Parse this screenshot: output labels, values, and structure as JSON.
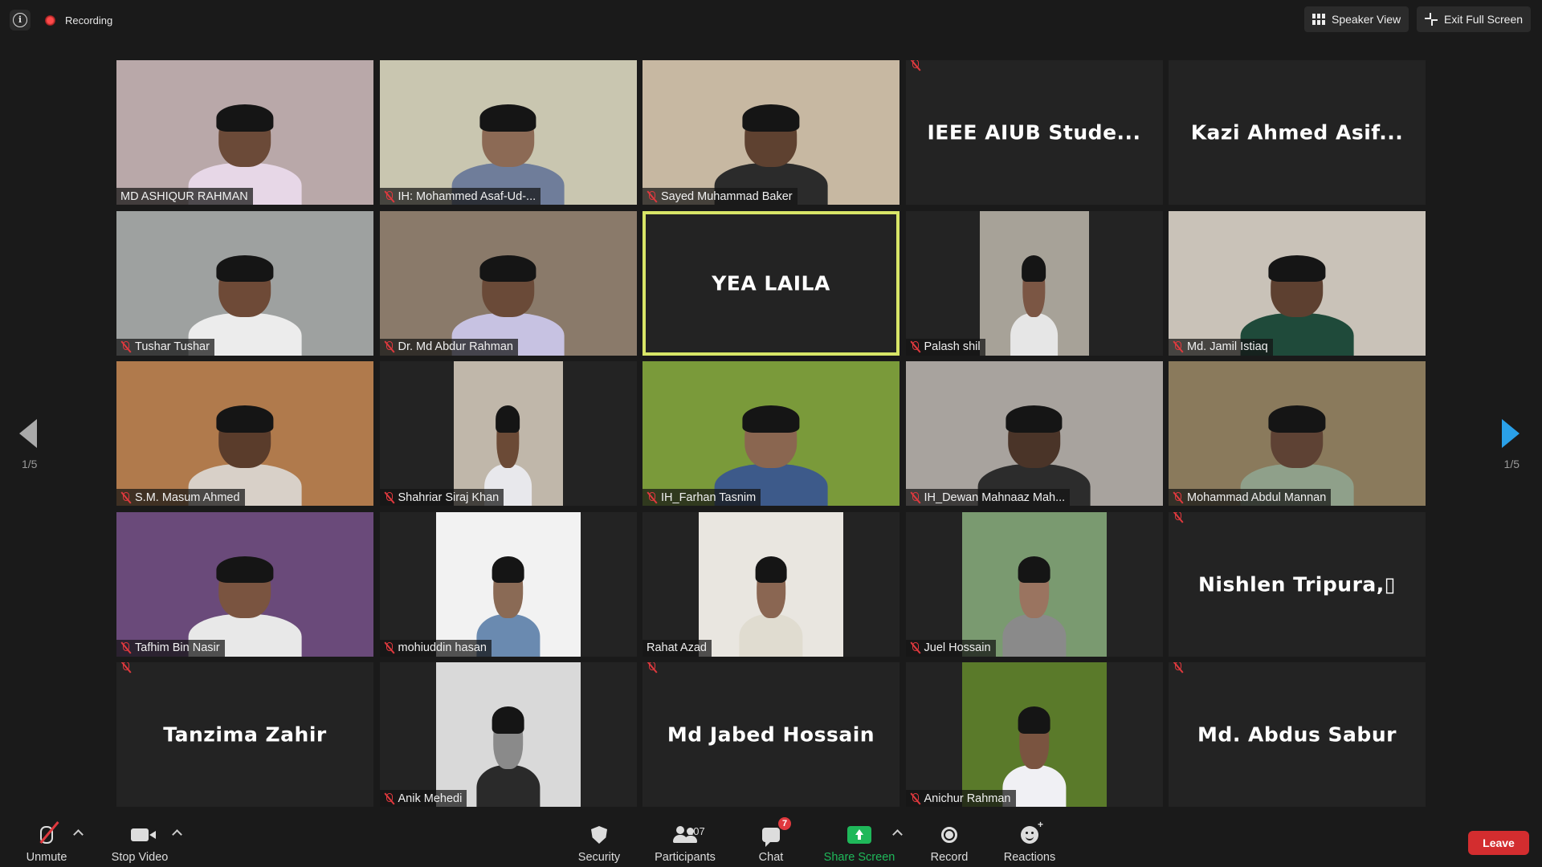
{
  "topbar": {
    "recording_label": "Recording",
    "speaker_view_label": "Speaker View",
    "exit_fullscreen_label": "Exit Full Screen"
  },
  "pagination": {
    "left": "1/5",
    "right": "1/5"
  },
  "participants": [
    {
      "name": "MD ASHIQUR RAHMAN",
      "video": true,
      "muted": false,
      "bg": "#b9a8a9",
      "skin": "#6b4a38",
      "shirt": "#e7d7e7"
    },
    {
      "name": "IH: Mohammed Asaf-Ud-...",
      "video": true,
      "muted": true,
      "bg": "#c9c6b0",
      "skin": "#8c6a55",
      "shirt": "#6f7d9a"
    },
    {
      "name": "Sayed Muhammad Baker",
      "video": true,
      "muted": true,
      "bg": "#c7b8a2",
      "skin": "#5e4130",
      "shirt": "#2b2b2b"
    },
    {
      "name": "IEEE AIUB Stude...",
      "video": false,
      "muted": true
    },
    {
      "name": "Kazi Ahmed Asif...",
      "video": false,
      "muted": false
    },
    {
      "name": "Tushar Tushar",
      "video": true,
      "muted": true,
      "bg": "#9ea1a0",
      "skin": "#6e4a37",
      "shirt": "#ececec"
    },
    {
      "name": "Dr. Md Abdur Rahman",
      "video": true,
      "muted": true,
      "bg": "#8a7a6a",
      "skin": "#6a4a38",
      "shirt": "#c7c2e2"
    },
    {
      "name": "YEA LAILA",
      "video": false,
      "muted": false,
      "active": true
    },
    {
      "name": "Palash shil",
      "video": true,
      "muted": true,
      "narrow": true,
      "bg": "#a7a298",
      "skin": "#7b5644",
      "shirt": "#e6e6e6"
    },
    {
      "name": "Md. Jamil Istiaq",
      "video": true,
      "muted": true,
      "bg": "#c9c2b8",
      "skin": "#5d4030",
      "shirt": "#1f4a3a"
    },
    {
      "name": "S.M. Masum Ahmed",
      "video": true,
      "muted": true,
      "bg": "#b07a4c",
      "skin": "#5a3c2b",
      "shirt": "#d8d0c8"
    },
    {
      "name": "Shahriar Siraj Khan",
      "video": true,
      "muted": true,
      "narrow": true,
      "bg": "#c0b7aa",
      "skin": "#6b4a36",
      "shirt": "#e8e8ec"
    },
    {
      "name": "IH_Farhan Tasnim",
      "video": true,
      "muted": true,
      "bg": "#7a9a3a",
      "skin": "#8a6650",
      "shirt": "#3d5a8a"
    },
    {
      "name": "IH_Dewan Mahnaaz Mah...",
      "video": true,
      "muted": true,
      "bg": "#a8a39e",
      "skin": "#4a3428",
      "shirt": "#2c2c2c"
    },
    {
      "name": "Mohammad Abdul Mannan",
      "video": true,
      "muted": true,
      "bg": "#8a7a5c",
      "skin": "#5e4234",
      "shirt": "#8fa08a"
    },
    {
      "name": "Tafhim Bin Nasir",
      "video": true,
      "muted": true,
      "bg": "#6a4a7a",
      "skin": "#7a5440",
      "shirt": "#e8e8e8"
    },
    {
      "name": "mohiuddin hasan",
      "video": true,
      "muted": true,
      "mid": true,
      "bg": "#f2f2f2",
      "skin": "#8a6a55",
      "shirt": "#6a8ab0"
    },
    {
      "name": "Rahat Azad",
      "video": true,
      "muted": false,
      "mid": true,
      "bg": "#e9e6e0",
      "skin": "#8a6652",
      "shirt": "#e0dcd0"
    },
    {
      "name": "Juel Hossain",
      "video": true,
      "muted": true,
      "mid": true,
      "bg": "#7a9a70",
      "skin": "#9a7460",
      "shirt": "#8a8a8a"
    },
    {
      "name": "Nishlen  Tripura,▯",
      "video": false,
      "muted": true
    },
    {
      "name": "Tanzima Zahir",
      "video": false,
      "muted": true
    },
    {
      "name": "Anik Mehedi",
      "video": true,
      "muted": true,
      "mid": true,
      "bg": "#d9d9d9",
      "skin": "#8a8a8a",
      "shirt": "#2a2a2a"
    },
    {
      "name": "Md Jabed Hossain",
      "video": false,
      "muted": true
    },
    {
      "name": "Anichur Rahman",
      "video": true,
      "muted": true,
      "mid": true,
      "bg": "#5a7a2a",
      "skin": "#7a5440",
      "shirt": "#f0f0f4"
    },
    {
      "name": "Md. Abdus Sabur",
      "video": false,
      "muted": true
    }
  ],
  "toolbar": {
    "unmute_label": "Unmute",
    "stop_video_label": "Stop Video",
    "security_label": "Security",
    "participants_label": "Participants",
    "participants_count": "107",
    "chat_label": "Chat",
    "chat_badge": "7",
    "share_screen_label": "Share Screen",
    "record_label": "Record",
    "reactions_label": "Reactions",
    "leave_label": "Leave"
  },
  "colors": {
    "active_speaker": "#d8e567",
    "share_green": "#1fb85a",
    "leave_red": "#d32d2f",
    "nav_blue": "#2aa0e8"
  }
}
